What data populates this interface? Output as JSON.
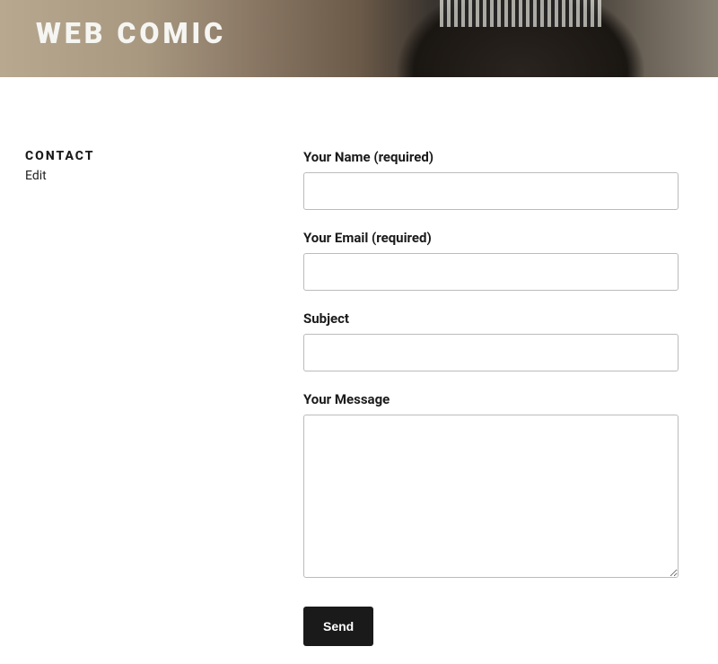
{
  "header": {
    "site_title": "WEB COMIC"
  },
  "sidebar": {
    "page_title": "CONTACT",
    "edit_link": "Edit"
  },
  "form": {
    "name_label": "Your Name (required)",
    "email_label": "Your Email (required)",
    "subject_label": "Subject",
    "message_label": "Your Message",
    "submit_label": "Send"
  }
}
